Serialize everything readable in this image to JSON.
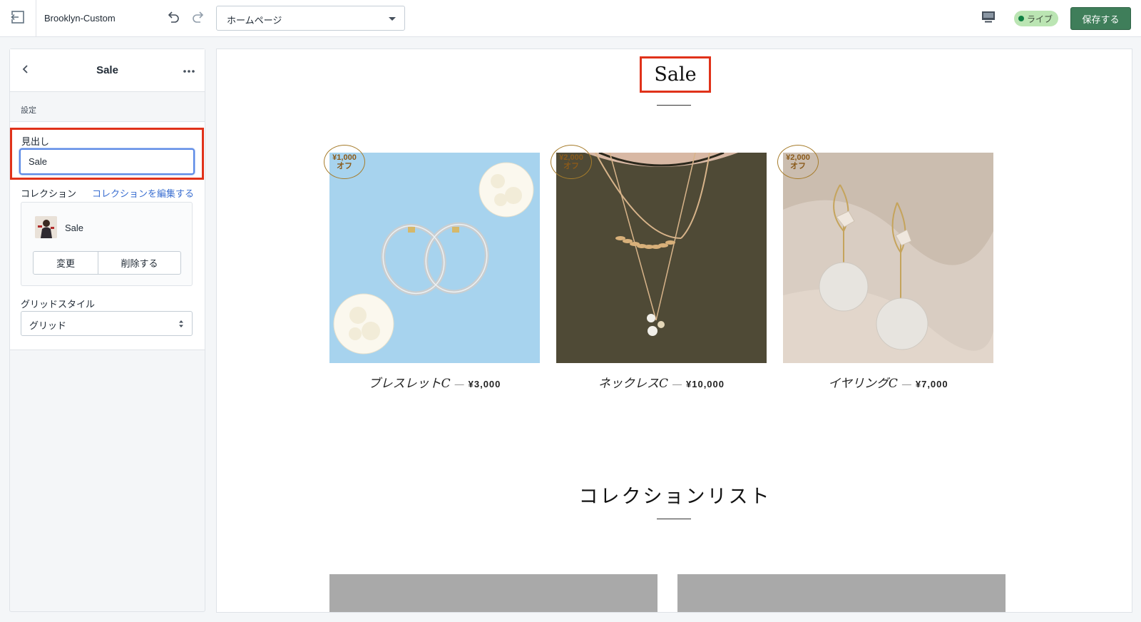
{
  "topbar": {
    "theme_name": "Brooklyn-Custom",
    "page_select_value": "ホームページ",
    "live_label": "ライブ",
    "save_label": "保存する"
  },
  "sidebar": {
    "section_title": "Sale",
    "settings_label": "設定",
    "heading_label": "見出し",
    "heading_value": "Sale",
    "collection_label": "コレクション",
    "collection_edit_link": "コレクションを編集する",
    "collection_name": "Sale",
    "change_label": "変更",
    "delete_label": "削除する",
    "grid_style_label": "グリッドスタイル",
    "grid_style_value": "グリッド"
  },
  "preview": {
    "heading": "Sale",
    "products": [
      {
        "title": "ブレスレットC",
        "price": "¥3,000",
        "badge_amount": "¥1,000",
        "badge_suffix": "オフ"
      },
      {
        "title": "ネックレスC",
        "price": "¥10,000",
        "badge_amount": "¥2,000",
        "badge_suffix": "オフ"
      },
      {
        "title": "イヤリングC",
        "price": "¥7,000",
        "badge_amount": "¥2,000",
        "badge_suffix": "オフ"
      }
    ],
    "dash": "—",
    "collection_list_title": "コレクションリスト"
  },
  "colors": {
    "save_green": "#3f7e5a",
    "live_badge_bg": "#bbe5b3",
    "highlight_red": "#e0321a",
    "link_blue": "#3b6fd1",
    "badge_gold": "#a67c2b"
  },
  "icons": {
    "exit": "exit-icon",
    "undo": "undo-icon",
    "redo": "redo-icon",
    "device": "desktop-icon",
    "back": "chevron-left-icon",
    "more": "more-horizontal-icon",
    "select_arrows": "select-arrows-icon"
  }
}
